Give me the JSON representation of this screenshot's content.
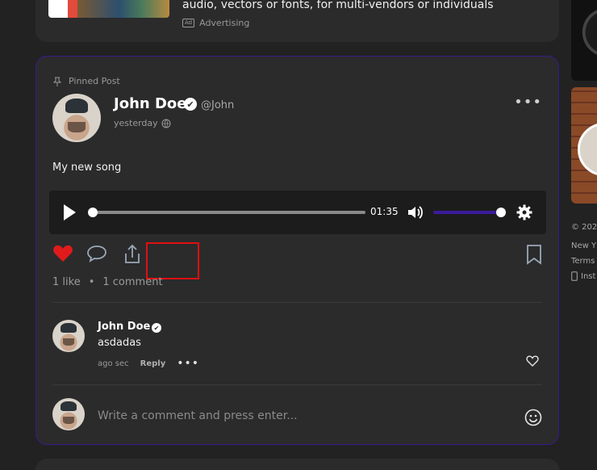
{
  "ad": {
    "text": "audio, vectors or fonts, for multi-vendors or individuals",
    "badge": "Ad",
    "label": "Advertising"
  },
  "post": {
    "pinned_label": "Pinned Post",
    "author_name": "John Doe",
    "verified_glyph": "✔",
    "handle": "@John",
    "time": "yesterday",
    "more_glyph": "•••",
    "text": "My new song",
    "player": {
      "current_time": "01:35",
      "progress": 0,
      "volume": 1.0
    },
    "likes": "1 like",
    "comments": "1 comment",
    "separator": "•"
  },
  "comment": {
    "author_name": "John Doe",
    "verified_glyph": "✔",
    "text": "asdadas",
    "time": "ago sec",
    "reply_label": "Reply",
    "more_glyph": "•••"
  },
  "composer": {
    "placeholder": "Write a comment and press enter..."
  },
  "sidebar": {
    "copyright": "© 202",
    "location": "New Y",
    "terms": "Terms",
    "install": "Inst"
  },
  "colors": {
    "accent": "#3b1a9c",
    "like": "#e01b1b",
    "highlight": "#e00f0f"
  },
  "icons": [
    "pin-icon",
    "verified-icon",
    "globe-icon",
    "play-icon",
    "volume-icon",
    "gear-icon",
    "heart-icon",
    "comment-icon",
    "share-icon",
    "bookmark-icon",
    "emoji-icon",
    "phone-icon"
  ]
}
